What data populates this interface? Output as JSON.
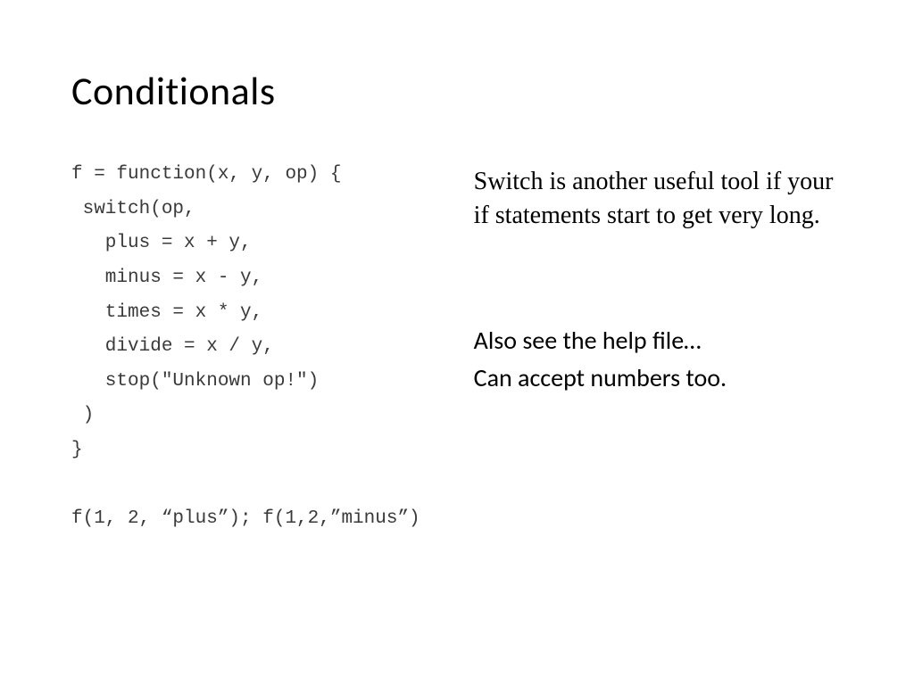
{
  "title": "Conditionals",
  "code": {
    "line1": "f = function(x, y, op) {",
    "line2": " switch(op,",
    "line3": "   plus = x + y,",
    "line4": "   minus = x - y,",
    "line5": "   times = x * y,",
    "line6": "   divide = x / y,",
    "line7": "   stop(\"Unknown op!\")",
    "line8": " )",
    "line9": "}",
    "blank": "",
    "call": "f(1, 2, “plus”); f(1,2,”minus”)"
  },
  "right": {
    "serif": "Switch is another useful tool if your if statements start to get very long.",
    "sans1": "Also see the help file…",
    "sans2": "Can accept numbers too."
  }
}
